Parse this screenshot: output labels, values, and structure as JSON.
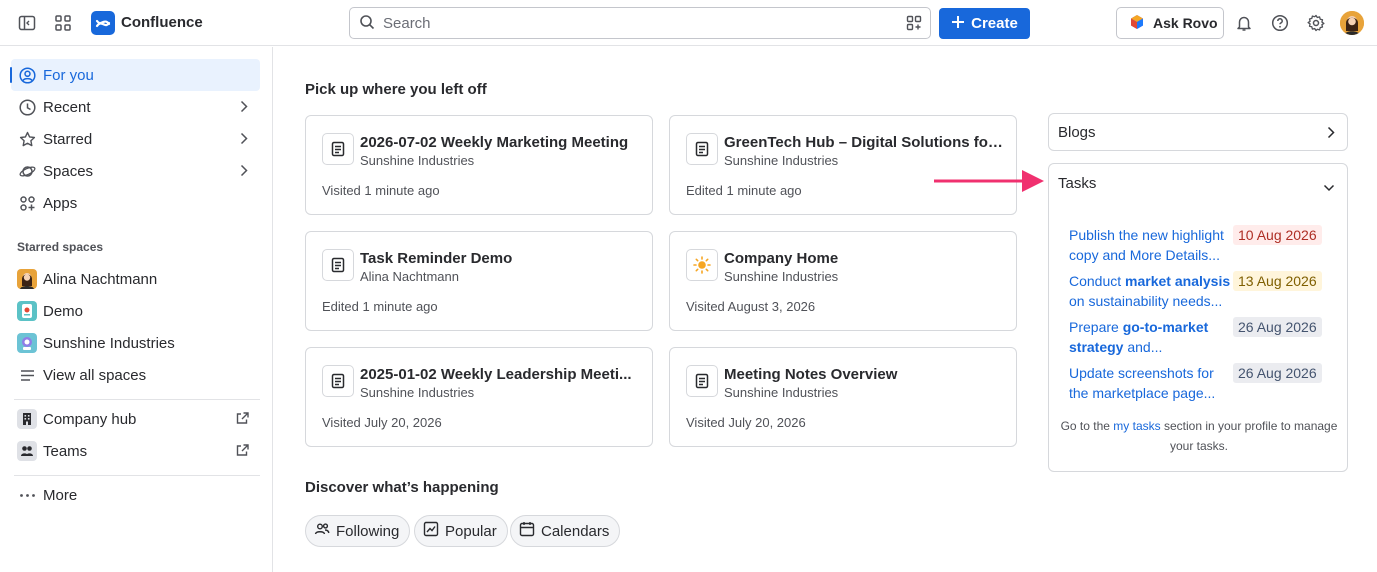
{
  "topbar": {
    "app_name": "Confluence",
    "search_placeholder": "Search",
    "create_label": "Create",
    "ask_rovo_label": "Ask Rovo",
    "icons": [
      "sidebar-toggle-icon",
      "app-switcher-icon",
      "confluence-logo-icon",
      "search-icon",
      "qr-scan-icon",
      "plus-icon",
      "rovo-icon",
      "bell-icon",
      "help-icon",
      "gear-icon"
    ]
  },
  "sidebar": {
    "items": [
      {
        "label": "For you",
        "icon": "user-circle-icon"
      },
      {
        "label": "Recent",
        "icon": "clock-icon"
      },
      {
        "label": "Starred",
        "icon": "star-icon"
      },
      {
        "label": "Spaces",
        "icon": "spaces-icon"
      },
      {
        "label": "Apps",
        "icon": "apps-icon"
      }
    ],
    "starred_label": "Starred spaces",
    "spaces": [
      {
        "label": "Alina Nachtmann"
      },
      {
        "label": "Demo"
      },
      {
        "label": "Sunshine Industries"
      }
    ],
    "view_all_label": "View all spaces",
    "company_hub_label": "Company hub",
    "teams_label": "Teams",
    "more_label": "More"
  },
  "main": {
    "pickup_title": "Pick up where you left off",
    "cards": [
      {
        "title": "2026-07-02 Weekly Marketing Meeting",
        "space": "Sunshine Industries",
        "meta": "Visited 1 minute ago",
        "icon": "page-icon"
      },
      {
        "title": "GreenTech Hub – Digital Solutions for ...",
        "space": "Sunshine Industries",
        "meta": "Edited 1 minute ago",
        "icon": "page-icon"
      },
      {
        "title": "Task Reminder Demo",
        "space": "Alina Nachtmann",
        "meta": "Edited 1 minute ago",
        "icon": "page-icon"
      },
      {
        "title": "Company Home",
        "space": "Sunshine Industries",
        "meta": "Visited August 3, 2026",
        "icon": "sun-icon"
      },
      {
        "title": "2025-01-02 Weekly Leadership Meeti...",
        "space": "Sunshine Industries",
        "meta": "Visited July 20, 2026",
        "icon": "page-icon"
      },
      {
        "title": "Meeting Notes Overview",
        "space": "Sunshine Industries",
        "meta": "Visited July 20, 2026",
        "icon": "page-icon"
      }
    ],
    "discover_title": "Discover what’s happening",
    "chips": [
      {
        "label": "Following",
        "icon": "people-icon"
      },
      {
        "label": "Popular",
        "icon": "trend-icon"
      },
      {
        "label": "Calendars",
        "icon": "calendar-icon"
      }
    ]
  },
  "right": {
    "blogs_label": "Blogs",
    "tasks_label": "Tasks",
    "tasks": [
      {
        "text_pre": "Publish the new highlight copy and More Details...",
        "text_bold": "",
        "text_post": "",
        "date": "10 Aug 2026",
        "date_color": "#ffeceb",
        "date_text": "#ae2e24"
      },
      {
        "text_pre": "Conduct ",
        "text_bold": "market analysis",
        "text_post": " on sustainability needs...",
        "date": "13 Aug 2026",
        "date_color": "#fff5db",
        "date_text": "#7f5f01"
      },
      {
        "text_pre": "Prepare ",
        "text_bold": "go-to-market strategy",
        "text_post": " and...",
        "date": "26 Aug 2026",
        "date_color": "#ebecf0",
        "date_text": "#44546f"
      },
      {
        "text_pre": "Update screenshots for the marketplace page...",
        "text_bold": "",
        "text_post": "",
        "date": "26 Aug 2026",
        "date_color": "#ebecf0",
        "date_text": "#44546f"
      }
    ],
    "footer_pre": "Go to the ",
    "footer_link": "my tasks",
    "footer_post": " section in your profile to manage your tasks."
  },
  "colors": {
    "accent": "#1868db",
    "arrow": "#f0306f"
  }
}
